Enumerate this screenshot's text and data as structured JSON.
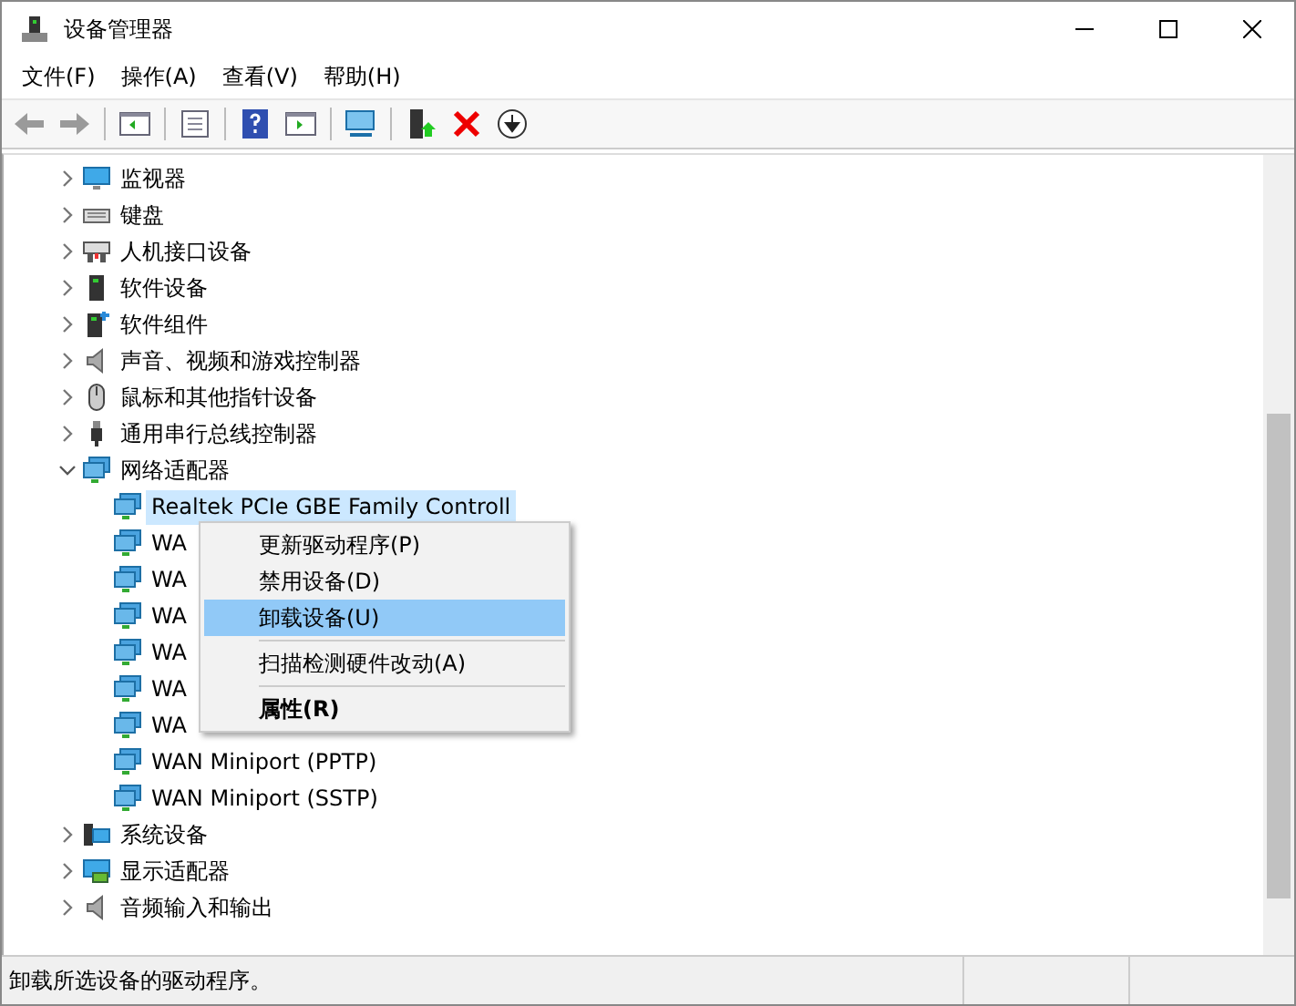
{
  "window": {
    "title": "设备管理器"
  },
  "menu_bar": [
    "文件(F)",
    "操作(A)",
    "查看(V)",
    "帮助(H)"
  ],
  "toolbar": [
    {
      "kind": "back",
      "disabled": true
    },
    {
      "kind": "forward",
      "disabled": true
    },
    {
      "kind": "sep"
    },
    {
      "kind": "tree"
    },
    {
      "kind": "sep"
    },
    {
      "kind": "props"
    },
    {
      "kind": "sep"
    },
    {
      "kind": "help"
    },
    {
      "kind": "pane"
    },
    {
      "kind": "sep"
    },
    {
      "kind": "scan"
    },
    {
      "kind": "sep"
    },
    {
      "kind": "update"
    },
    {
      "kind": "remove"
    },
    {
      "kind": "download"
    }
  ],
  "tree": [
    {
      "label": "监视器",
      "kind": "monitor",
      "expanded": false
    },
    {
      "label": "键盘",
      "kind": "keyboard",
      "expanded": false
    },
    {
      "label": "人机接口设备",
      "kind": "hid",
      "expanded": false
    },
    {
      "label": "软件设备",
      "kind": "tower",
      "expanded": false
    },
    {
      "label": "软件组件",
      "kind": "component",
      "expanded": false
    },
    {
      "label": "声音、视频和游戏控制器",
      "kind": "speaker",
      "expanded": false
    },
    {
      "label": "鼠标和其他指针设备",
      "kind": "mouse",
      "expanded": false
    },
    {
      "label": "通用串行总线控制器",
      "kind": "usb",
      "expanded": false
    },
    {
      "label": "网络适配器",
      "kind": "network",
      "expanded": true,
      "children": [
        {
          "label": "Realtek PCIe GBE Family Controll",
          "selected": true
        },
        {
          "label": "WA",
          "selected": false
        },
        {
          "label": "WA",
          "selected": false
        },
        {
          "label": "WA",
          "selected": false
        },
        {
          "label": "WA",
          "selected": false
        },
        {
          "label": "WA",
          "selected": false
        },
        {
          "label": "WA",
          "selected": false
        },
        {
          "label": "WAN Miniport (PPTP)",
          "selected": false
        },
        {
          "label": "WAN Miniport (SSTP)",
          "selected": false
        }
      ]
    },
    {
      "label": "系统设备",
      "kind": "system",
      "expanded": false
    },
    {
      "label": "显示适配器",
      "kind": "display",
      "expanded": false
    },
    {
      "label": "音频输入和输出",
      "kind": "speaker",
      "expanded": false
    }
  ],
  "context_menu": [
    {
      "kind": "item",
      "label": "更新驱动程序(P)",
      "selected": false,
      "bold": false
    },
    {
      "kind": "item",
      "label": "禁用设备(D)",
      "selected": false,
      "bold": false
    },
    {
      "kind": "item",
      "label": "卸载设备(U)",
      "selected": true,
      "bold": false
    },
    {
      "kind": "separator"
    },
    {
      "kind": "item",
      "label": "扫描检测硬件改动(A)",
      "selected": false,
      "bold": false
    },
    {
      "kind": "separator"
    },
    {
      "kind": "item",
      "label": "属性(R)",
      "selected": false,
      "bold": true
    }
  ],
  "status_bar": "卸载所选设备的驱动程序。"
}
